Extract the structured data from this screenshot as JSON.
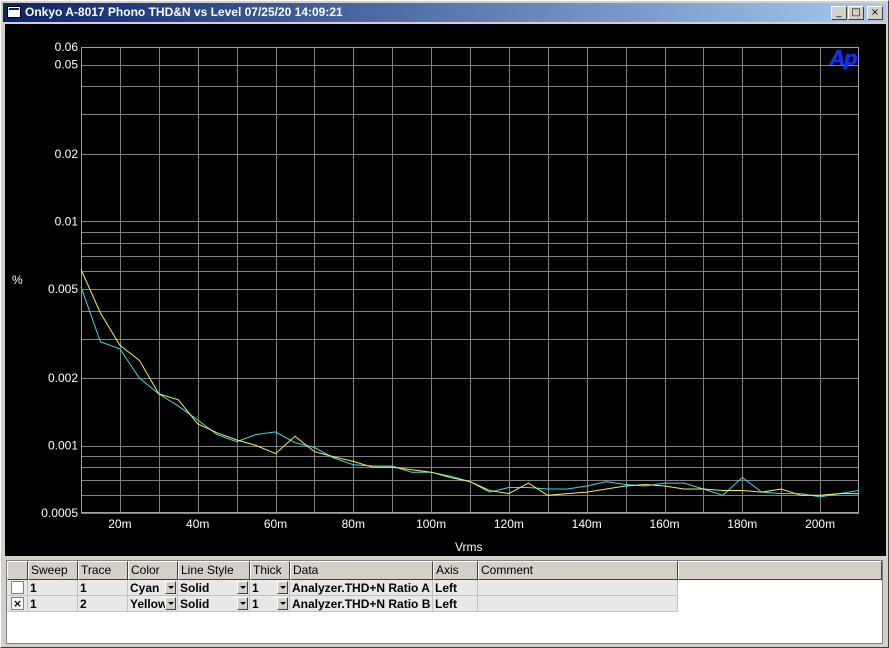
{
  "window": {
    "title": "Onkyo A-8017 Phono THD&N vs Level  07/25/20 14:09:21",
    "buttons": {
      "minimize": "_",
      "maximize": "□",
      "close": "×"
    }
  },
  "logo_text": "Ap",
  "chart_data": {
    "type": "line",
    "xlabel": "Vrms",
    "ylabel": "%",
    "y_scale": "log",
    "xlim": [
      0.01,
      0.21
    ],
    "ylim": [
      0.0005,
      0.06
    ],
    "x_ticks": [
      0.02,
      0.04,
      0.06,
      0.08,
      0.1,
      0.12,
      0.14,
      0.16,
      0.18,
      0.2
    ],
    "x_tick_labels": [
      "20m",
      "40m",
      "60m",
      "80m",
      "100m",
      "120m",
      "140m",
      "160m",
      "180m",
      "200m"
    ],
    "y_ticks": [
      0.0005,
      0.001,
      0.002,
      0.005,
      0.01,
      0.02,
      0.05,
      0.06
    ],
    "y_tick_labels": [
      "0.0005",
      "0.001",
      "0.002",
      "0.005",
      "0.01",
      "0.02",
      "0.05",
      "0.06"
    ],
    "grid": true,
    "series": [
      {
        "color": "#40d8e8",
        "x": [
          0.01,
          0.015,
          0.02,
          0.025,
          0.03,
          0.035,
          0.04,
          0.045,
          0.05,
          0.055,
          0.06,
          0.065,
          0.07,
          0.075,
          0.08,
          0.085,
          0.09,
          0.095,
          0.1,
          0.105,
          0.11,
          0.115,
          0.12,
          0.125,
          0.13,
          0.135,
          0.14,
          0.145,
          0.15,
          0.155,
          0.16,
          0.165,
          0.17,
          0.175,
          0.18,
          0.185,
          0.19,
          0.195,
          0.2,
          0.205,
          0.21
        ],
        "values": [
          0.0051,
          0.0029,
          0.0027,
          0.002,
          0.0017,
          0.0015,
          0.0013,
          0.00112,
          0.00104,
          0.00112,
          0.00115,
          0.00103,
          0.00098,
          0.00088,
          0.00082,
          0.00081,
          0.00081,
          0.00076,
          0.00076,
          0.00073,
          0.00069,
          0.00062,
          0.00065,
          0.00065,
          0.00064,
          0.00064,
          0.00066,
          0.00069,
          0.00067,
          0.00066,
          0.00068,
          0.00068,
          0.00064,
          0.0006,
          0.00072,
          0.00062,
          0.00061,
          0.00061,
          0.00059,
          0.00061,
          0.00063
        ]
      },
      {
        "color": "#f0f050",
        "x": [
          0.01,
          0.015,
          0.02,
          0.025,
          0.03,
          0.035,
          0.04,
          0.045,
          0.05,
          0.055,
          0.06,
          0.065,
          0.07,
          0.075,
          0.08,
          0.085,
          0.09,
          0.095,
          0.1,
          0.105,
          0.11,
          0.115,
          0.12,
          0.125,
          0.13,
          0.135,
          0.14,
          0.145,
          0.15,
          0.155,
          0.16,
          0.165,
          0.17,
          0.175,
          0.18,
          0.185,
          0.19,
          0.195,
          0.2,
          0.205,
          0.21
        ],
        "values": [
          0.0061,
          0.0039,
          0.0028,
          0.0024,
          0.0017,
          0.0016,
          0.00125,
          0.00114,
          0.00106,
          0.001,
          0.00092,
          0.0011,
          0.00094,
          0.00089,
          0.00085,
          0.0008,
          0.0008,
          0.00078,
          0.00076,
          0.00072,
          0.00069,
          0.00063,
          0.00061,
          0.00068,
          0.0006,
          0.00061,
          0.00062,
          0.00064,
          0.00066,
          0.00067,
          0.00066,
          0.00064,
          0.00064,
          0.00063,
          0.00063,
          0.00062,
          0.00064,
          0.0006,
          0.0006,
          0.00061,
          0.00061
        ]
      }
    ]
  },
  "trace_table": {
    "headers": [
      "",
      "Sweep",
      "Trace",
      "Color",
      "Line Style",
      "Thick",
      "Data",
      "Axis",
      "Comment"
    ],
    "rows": [
      {
        "checked": "",
        "sweep": "1",
        "trace": "1",
        "color": "Cyan",
        "line_style": "Solid",
        "thick": "1",
        "data": "Analyzer.THD+N Ratio A",
        "axis": "Left",
        "comment": ""
      },
      {
        "checked": "×",
        "sweep": "1",
        "trace": "2",
        "color": "Yellow",
        "line_style": "Solid",
        "thick": "1",
        "data": "Analyzer.THD+N Ratio B",
        "axis": "Left",
        "comment": ""
      }
    ]
  }
}
